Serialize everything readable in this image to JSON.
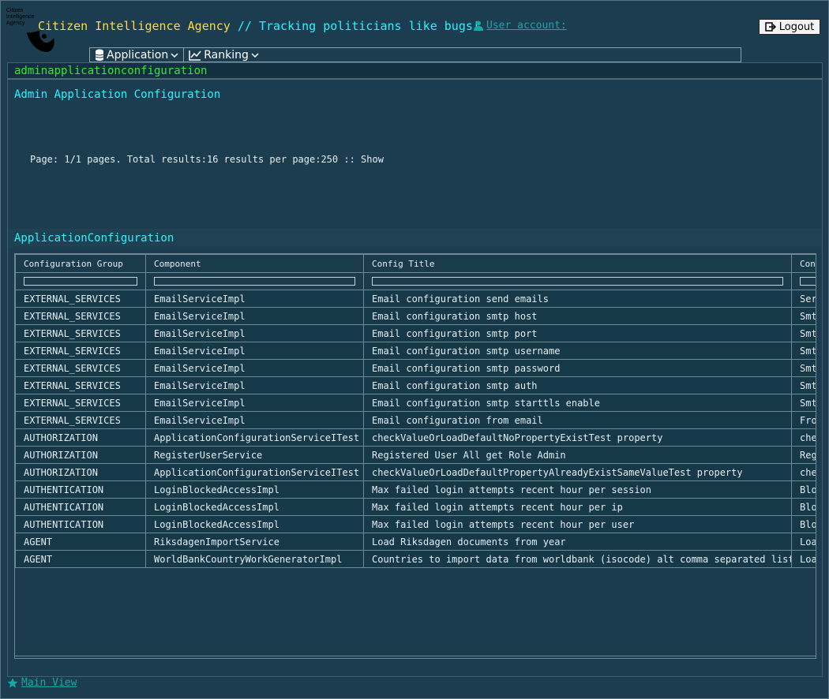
{
  "header": {
    "logo_text": "Citizen Intelligence Agency",
    "title": "Citizen Intelligence Agency",
    "tagline": "// Tracking politicians like bugs!",
    "user_account": "User account:",
    "logout": "Logout"
  },
  "menu": [
    {
      "label": "Application",
      "icon": "database-icon"
    },
    {
      "label": "Ranking",
      "icon": "chart-line-icon"
    }
  ],
  "page": {
    "caption": "adminapplicationconfiguration",
    "heading": "Admin Application Configuration",
    "pager": "Page: 1/1 pages. Total results:16 results per page:250 :: Show",
    "section_title": "ApplicationConfiguration"
  },
  "table": {
    "columns": [
      "Configuration Group",
      "Component",
      "Config Title",
      "Con"
    ],
    "rows": [
      [
        "EXTERNAL_SERVICES",
        "EmailServiceImpl",
        "Email configuration send emails",
        "Ser"
      ],
      [
        "EXTERNAL_SERVICES",
        "EmailServiceImpl",
        "Email configuration smtp host",
        "Smt"
      ],
      [
        "EXTERNAL_SERVICES",
        "EmailServiceImpl",
        "Email configuration smtp port",
        "Smt"
      ],
      [
        "EXTERNAL_SERVICES",
        "EmailServiceImpl",
        "Email configuration smtp username",
        "Smt"
      ],
      [
        "EXTERNAL_SERVICES",
        "EmailServiceImpl",
        "Email configuration smtp password",
        "Smt"
      ],
      [
        "EXTERNAL_SERVICES",
        "EmailServiceImpl",
        "Email configuration smtp auth",
        "Smt"
      ],
      [
        "EXTERNAL_SERVICES",
        "EmailServiceImpl",
        "Email configuration smtp starttls enable",
        "Smt"
      ],
      [
        "EXTERNAL_SERVICES",
        "EmailServiceImpl",
        "Email configuration from email",
        "Fro"
      ],
      [
        "AUTHORIZATION",
        "ApplicationConfigurationServiceITest",
        "checkValueOrLoadDefaultNoPropertyExistTest property",
        "che"
      ],
      [
        "AUTHORIZATION",
        "RegisterUserService",
        "Registered User All get Role Admin",
        "Reg"
      ],
      [
        "AUTHORIZATION",
        "ApplicationConfigurationServiceITest",
        "checkValueOrLoadDefaultPropertyAlreadyExistSameValueTest property",
        "che"
      ],
      [
        "AUTHENTICATION",
        "LoginBlockedAccessImpl",
        "Max failed login attempts recent hour per session",
        "Blo"
      ],
      [
        "AUTHENTICATION",
        "LoginBlockedAccessImpl",
        "Max failed login attempts recent hour per ip",
        "Blo"
      ],
      [
        "AUTHENTICATION",
        "LoginBlockedAccessImpl",
        "Max failed login attempts recent hour per user",
        "Blo"
      ],
      [
        "AGENT",
        "RiksdagenImportService",
        "Load Riksdagen documents from year",
        "Loa"
      ],
      [
        "AGENT",
        "WorldBankCountryWorkGeneratorImpl",
        "Countries to import data from worldbank (isocode) alt comma separated list",
        "Loa"
      ]
    ]
  },
  "footer": {
    "main_view": "Main View"
  }
}
